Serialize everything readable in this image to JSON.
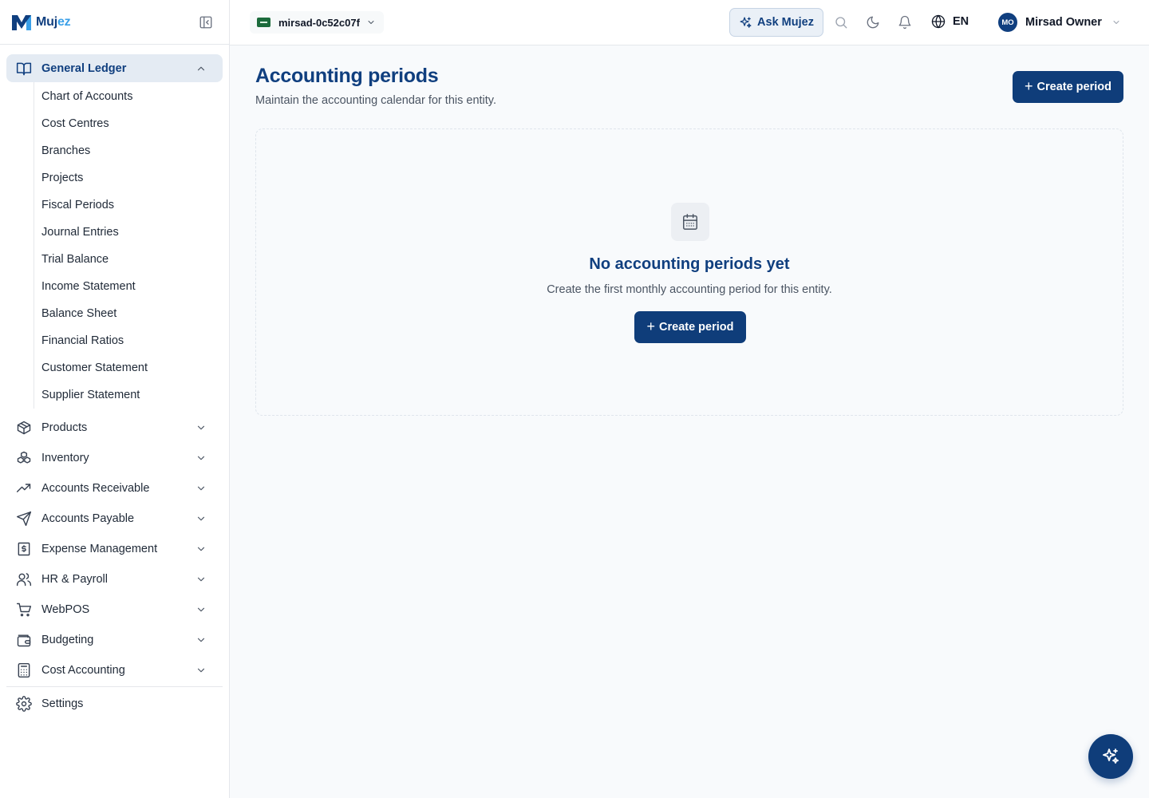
{
  "brand": {
    "name_part1": "Muj",
    "name_part2": "ez"
  },
  "sidebar": {
    "active_group": {
      "label": "General Ledger"
    },
    "sub_items": [
      "Chart of Accounts",
      "Cost Centres",
      "Branches",
      "Projects",
      "Fiscal Periods",
      "Journal Entries",
      "Trial Balance",
      "Income Statement",
      "Balance Sheet",
      "Financial Ratios",
      "Customer Statement",
      "Supplier Statement"
    ],
    "groups": [
      {
        "label": "Products",
        "icon": "package-icon"
      },
      {
        "label": "Inventory",
        "icon": "boxes-icon"
      },
      {
        "label": "Accounts Receivable",
        "icon": "trending-up-icon"
      },
      {
        "label": "Accounts Payable",
        "icon": "send-icon"
      },
      {
        "label": "Expense Management",
        "icon": "receipt-icon"
      },
      {
        "label": "HR & Payroll",
        "icon": "users-icon"
      },
      {
        "label": "WebPOS",
        "icon": "cart-icon"
      },
      {
        "label": "Budgeting",
        "icon": "wallet-icon"
      },
      {
        "label": "Cost Accounting",
        "icon": "calculator-icon"
      }
    ],
    "settings": {
      "label": "Settings"
    }
  },
  "header": {
    "entity_name": "mirsad-0c52c07f",
    "ask_label": "Ask Mujez",
    "language": "EN",
    "user_initials": "MO",
    "user_name": "Mirsad Owner"
  },
  "page": {
    "title": "Accounting periods",
    "subtitle": "Maintain the accounting calendar for this entity.",
    "create_button": "Create period"
  },
  "empty_state": {
    "title": "No accounting periods yet",
    "description": "Create the first monthly accounting period for this entity.",
    "button": "Create period"
  },
  "colors": {
    "primary": "#0f3d7a",
    "brand_accent": "#3aa0e8",
    "active_nav_bg": "#e4ebf3"
  }
}
